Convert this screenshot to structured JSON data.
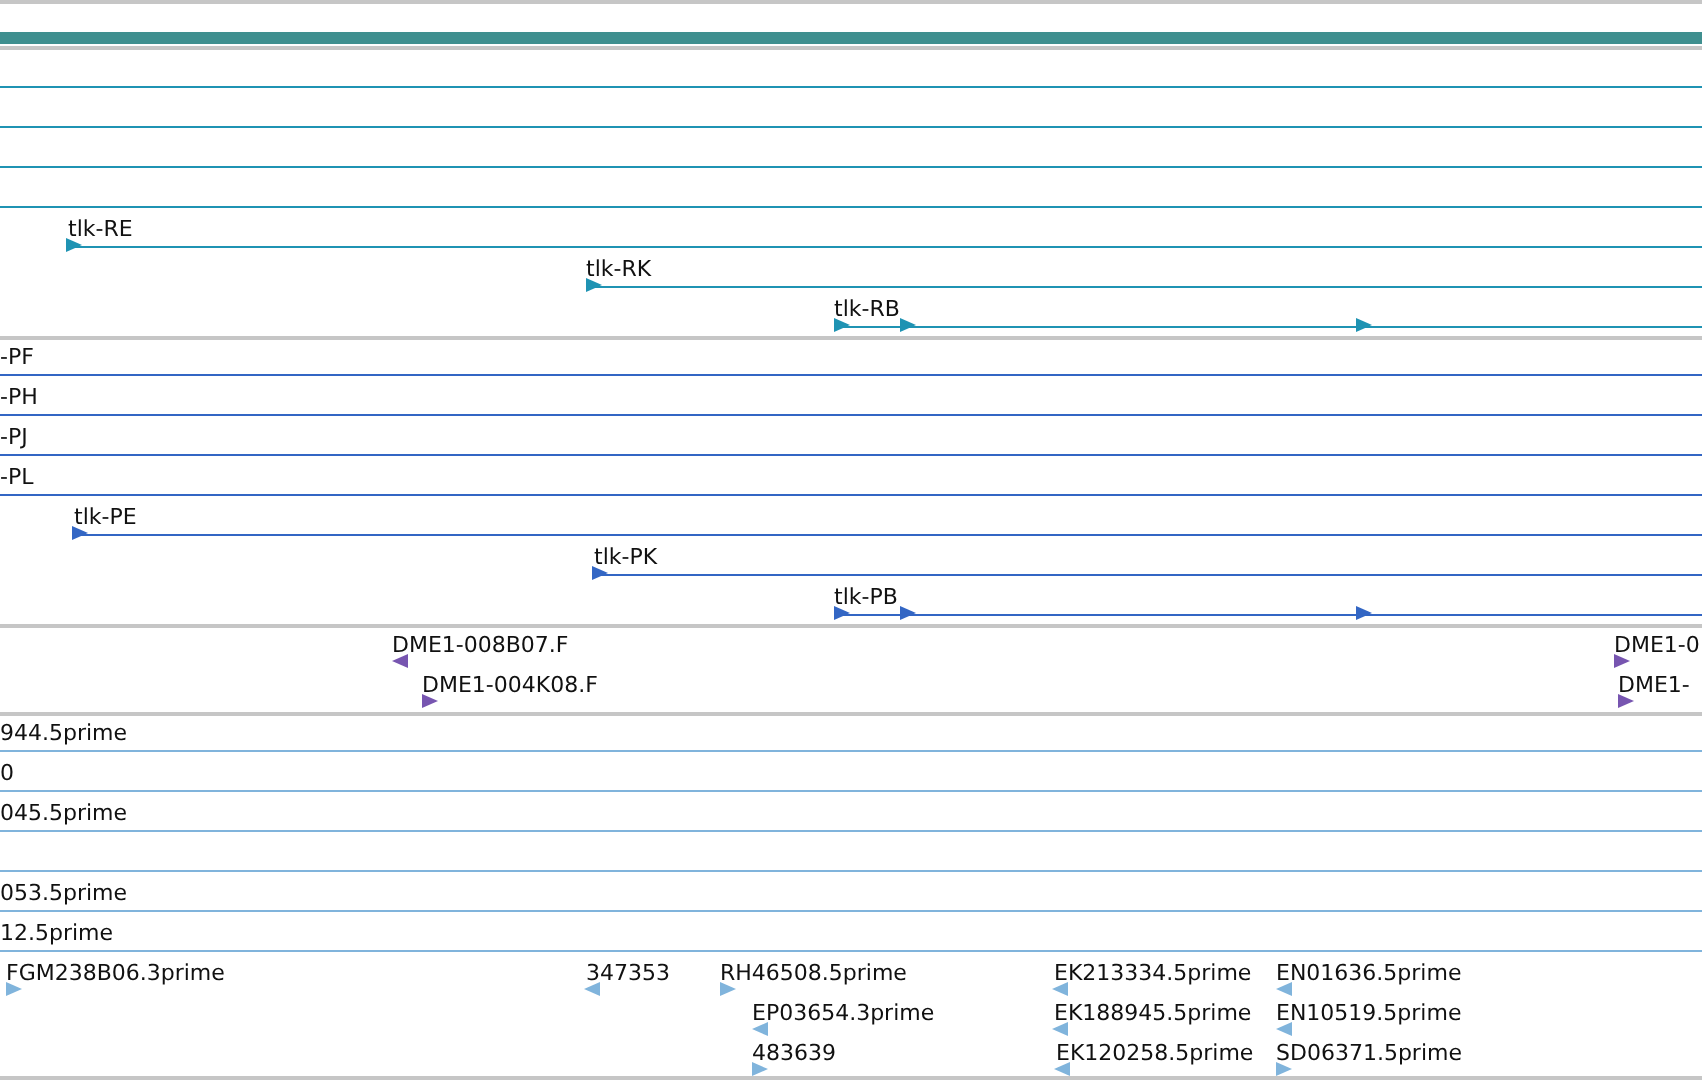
{
  "tracks": [
    {
      "color": "#1f93b3",
      "features": [
        {
          "kind": "line"
        },
        {
          "kind": "line"
        },
        {
          "kind": "line"
        },
        {
          "kind": "line"
        },
        {
          "kind": "line",
          "label": "tlk-RE",
          "reverse": false
        },
        {
          "kind": "line",
          "label": "tlk-RK",
          "reverse": false
        },
        {
          "kind": "line",
          "label": "tlk-RB",
          "reverse": false
        }
      ]
    },
    {
      "color": "#3366c4",
      "features": [
        {
          "kind": "line",
          "label": "-PF"
        },
        {
          "kind": "line",
          "label": "-PH"
        },
        {
          "kind": "line",
          "label": "-PJ"
        },
        {
          "kind": "line",
          "label": "-PL"
        },
        {
          "kind": "line",
          "label": "tlk-PE",
          "reverse": false
        },
        {
          "kind": "line",
          "label": "tlk-PK",
          "reverse": false
        },
        {
          "kind": "line",
          "label": "tlk-PB",
          "reverse": false
        }
      ]
    },
    {
      "color": "#7755b0",
      "features": [
        {
          "kind": "point",
          "label": "DME1-008B07.F",
          "reverse": true
        },
        {
          "kind": "point",
          "label": "DME1-004K08.F",
          "reverse": false
        },
        {
          "kind": "point",
          "label": "DME1-0",
          "reverse": false
        },
        {
          "kind": "point",
          "label": "DME1-",
          "reverse": false
        }
      ]
    },
    {
      "color": "#80b4dc",
      "features": [
        {
          "kind": "line",
          "label": "944.5prime"
        },
        {
          "kind": "line",
          "label": "0"
        },
        {
          "kind": "line",
          "label": "045.5prime"
        },
        {
          "kind": "line"
        },
        {
          "kind": "line",
          "label": "053.5prime"
        },
        {
          "kind": "line",
          "label": "12.5prime"
        },
        {
          "kind": "point",
          "label": "FGM238B06.3prime",
          "reverse": false
        },
        {
          "kind": "point",
          "label": "347353",
          "reverse": true
        },
        {
          "kind": "point",
          "label": "RH46508.5prime",
          "reverse": false
        },
        {
          "kind": "point",
          "label": "EP03654.3prime",
          "reverse": true
        },
        {
          "kind": "point",
          "label": "483639",
          "reverse": false
        },
        {
          "kind": "point",
          "label": "EK213334.5prime",
          "reverse": true
        },
        {
          "kind": "point",
          "label": "EK188945.5prime",
          "reverse": true
        },
        {
          "kind": "point",
          "label": "EK120258.5prime",
          "reverse": true
        },
        {
          "kind": "point",
          "label": "EN01636.5prime",
          "reverse": true
        },
        {
          "kind": "point",
          "label": "EN10519.5prime",
          "reverse": true
        },
        {
          "kind": "point",
          "label": "SD06371.5prime",
          "reverse": false
        }
      ]
    }
  ]
}
